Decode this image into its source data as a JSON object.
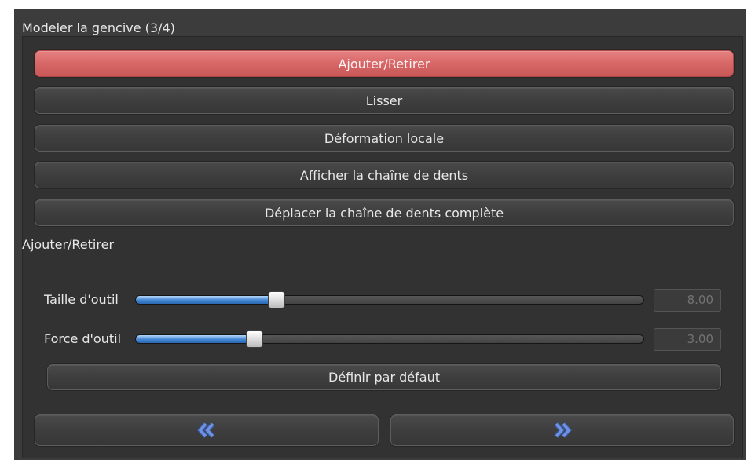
{
  "panel": {
    "title": "Modeler la gencive (3/4)"
  },
  "tools": [
    {
      "label": "Ajouter/Retirer",
      "active": true
    },
    {
      "label": "Lisser",
      "active": false
    },
    {
      "label": "Déformation locale",
      "active": false
    },
    {
      "label": "Afficher la chaîne de dents",
      "active": false
    },
    {
      "label": "Déplacer la chaîne de dents complète",
      "active": false
    }
  ],
  "tool_options": {
    "heading": "Ajouter/Retirer",
    "sliders": [
      {
        "label": "Taille d'outil",
        "value": "8.00",
        "level": 0.27
      },
      {
        "label": "Force d'outil",
        "value": "3.00",
        "level": 0.225
      }
    ],
    "reset_label": "Définir par défaut"
  },
  "navigation": {
    "back_icon": "double-chevron-left-icon",
    "next_icon": "double-chevron-right-icon"
  },
  "colors": {
    "active_tool": "#d86767",
    "panel": "#3c3c3c",
    "slider_fill": "#4a8ad6",
    "nav_icon": "#6f92e2"
  }
}
